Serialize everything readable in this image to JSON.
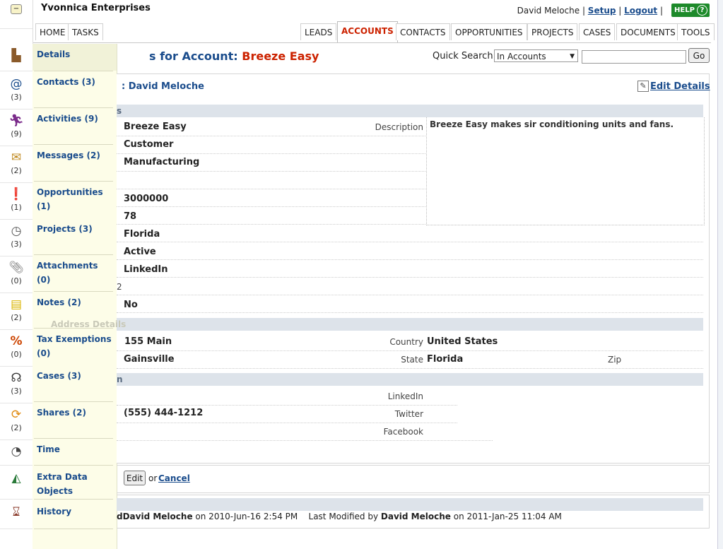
{
  "header": {
    "company": "Yvonnica Enterprises",
    "user": "David Meloche",
    "setup": "Setup",
    "logout": "Logout",
    "help": "HELP",
    "left_tabs": [
      "HOME",
      "TASKS"
    ],
    "right_tabs": [
      "LEADS",
      "ACCOUNTS",
      "CONTACTS",
      "OPPORTUNITIES",
      "PROJECTS",
      "CASES",
      "DOCUMENTS",
      "TOOLS"
    ],
    "active_tab": "ACCOUNTS"
  },
  "icons": [
    {
      "icon": "account-building-icon",
      "count": ""
    },
    {
      "icon": "contacts-book-icon",
      "count": "(3)"
    },
    {
      "icon": "activities-person-icon",
      "count": "(9)"
    },
    {
      "icon": "messages-envelope-icon",
      "count": "(2)"
    },
    {
      "icon": "opportunities-alert-icon",
      "count": "(1)"
    },
    {
      "icon": "projects-clock-icon",
      "count": "(3)"
    },
    {
      "icon": "attachments-paperclip-icon",
      "count": "(0)"
    },
    {
      "icon": "notes-icon",
      "count": "(2)"
    },
    {
      "icon": "tax-percent-icon",
      "count": "(0)"
    },
    {
      "icon": "cases-headset-icon",
      "count": "(3)"
    },
    {
      "icon": "shares-cycle-icon",
      "count": "(2)"
    },
    {
      "icon": "time-clock-icon",
      "count": ""
    },
    {
      "icon": "extra-data-shapes-icon",
      "count": ""
    },
    {
      "icon": "history-hourglass-icon",
      "count": ""
    }
  ],
  "menu": {
    "details": "Details",
    "contacts": "Contacts (3)",
    "activities": "Activities (9)",
    "messages": "Messages (2)",
    "opportunities_1": "Opportunities",
    "opportunities_2": "(1)",
    "projects": "Projects (3)",
    "attachments": "Attachments (0)",
    "notes": "Notes (2)",
    "tax_1": "Tax Exemptions",
    "tax_2": "(0)",
    "cases": "Cases (3)",
    "shares": "Shares (2)",
    "time": "Time",
    "extra_1": "Extra Data",
    "extra_2": "Objects",
    "history": "History"
  },
  "page": {
    "title_prefix": "s for Account: ",
    "title_name": "Breeze Easy",
    "quick_search": "Quick Search",
    "search_scope": "In Accounts",
    "go": "Go",
    "contact": ": David Meloche",
    "edit_details": "Edit Details"
  },
  "details": {
    "section": "s",
    "account_name": "Breeze Easy",
    "type": "Customer",
    "industry": "Manufacturing",
    "annual_revenue": "3000000",
    "employees": "78",
    "book": "Florida",
    "status": "Active",
    "source": "LinkedIn",
    "extra_field_value": "2",
    "opt_value": "No",
    "description_label": "Description",
    "description": "Breeze Easy makes sir conditioning units and fans."
  },
  "address": {
    "section": "Address Details",
    "street": "155 Main",
    "city": "Gainsville",
    "country_label": "Country",
    "country": "United States",
    "state_label": "State",
    "state": "Florida",
    "zip_label": "Zip"
  },
  "communication": {
    "section": "n",
    "phone": "(555) 444-1212",
    "linkedin": "LinkedIn",
    "twitter": "Twitter",
    "facebook": "Facebook"
  },
  "actions": {
    "edit": "Edit",
    "or": "or",
    "cancel": "Cancel"
  },
  "history": {
    "created_prefix": "d",
    "created_by": "David Meloche",
    "created_on": "on 2010-Jun-16 2:54 PM",
    "modified_label": "Last Modified by",
    "modified_by": "David Meloche",
    "modified_on": "on 2011-Jan-25 11:04 AM"
  }
}
